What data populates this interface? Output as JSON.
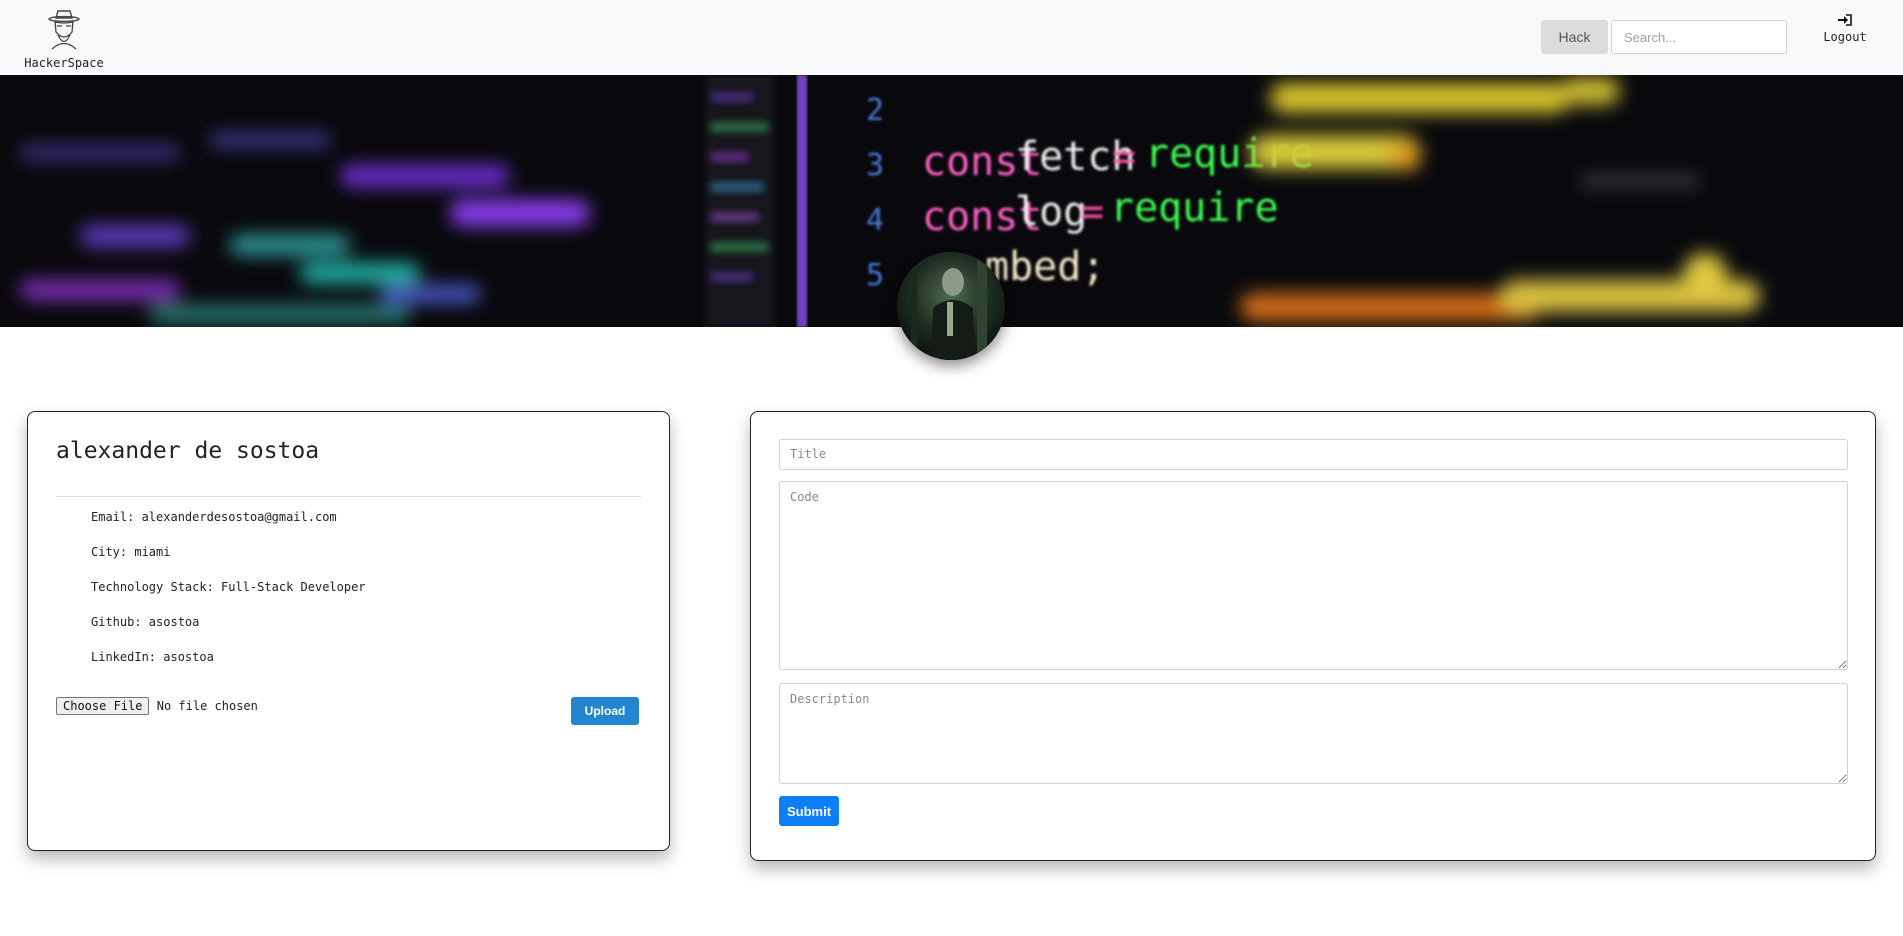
{
  "navbar": {
    "brand_name": "HackerSpace",
    "hack_label": "Hack",
    "search_placeholder": "Search...",
    "logout_label": "Logout",
    "logo_icon": "hacker-hat-icon",
    "logout_icon": "sign-in-icon"
  },
  "banner": {
    "code_lines": [
      {
        "number": "2",
        "text": ""
      },
      {
        "number": "3",
        "keyword": "const",
        "name": "fetch",
        "op": "=",
        "call": "require"
      },
      {
        "number": "4",
        "keyword": "const",
        "name": "log",
        "op": "=",
        "call": "require"
      },
      {
        "number": "5",
        "tail": "mbed;"
      }
    ]
  },
  "profile": {
    "name": "alexander de sostoa",
    "info": [
      "Email: alexanderdesostoa@gmail.com",
      "City: miami",
      "Technology Stack: Full-Stack Developer",
      "Github: asostoa",
      "LinkedIn: asostoa"
    ],
    "choose_file_label": "Choose File",
    "no_file_text": "No file chosen",
    "upload_label": "Upload"
  },
  "post_form": {
    "title_placeholder": "Title",
    "code_placeholder": "Code",
    "description_placeholder": "Description",
    "submit_label": "Submit"
  },
  "colors": {
    "navbar_bg": "#f8f9fa",
    "upload_button": "#2185d0",
    "submit_button": "#0d7ef5",
    "code_keyword": "#ff5ec8",
    "code_call": "#3dff4f"
  }
}
